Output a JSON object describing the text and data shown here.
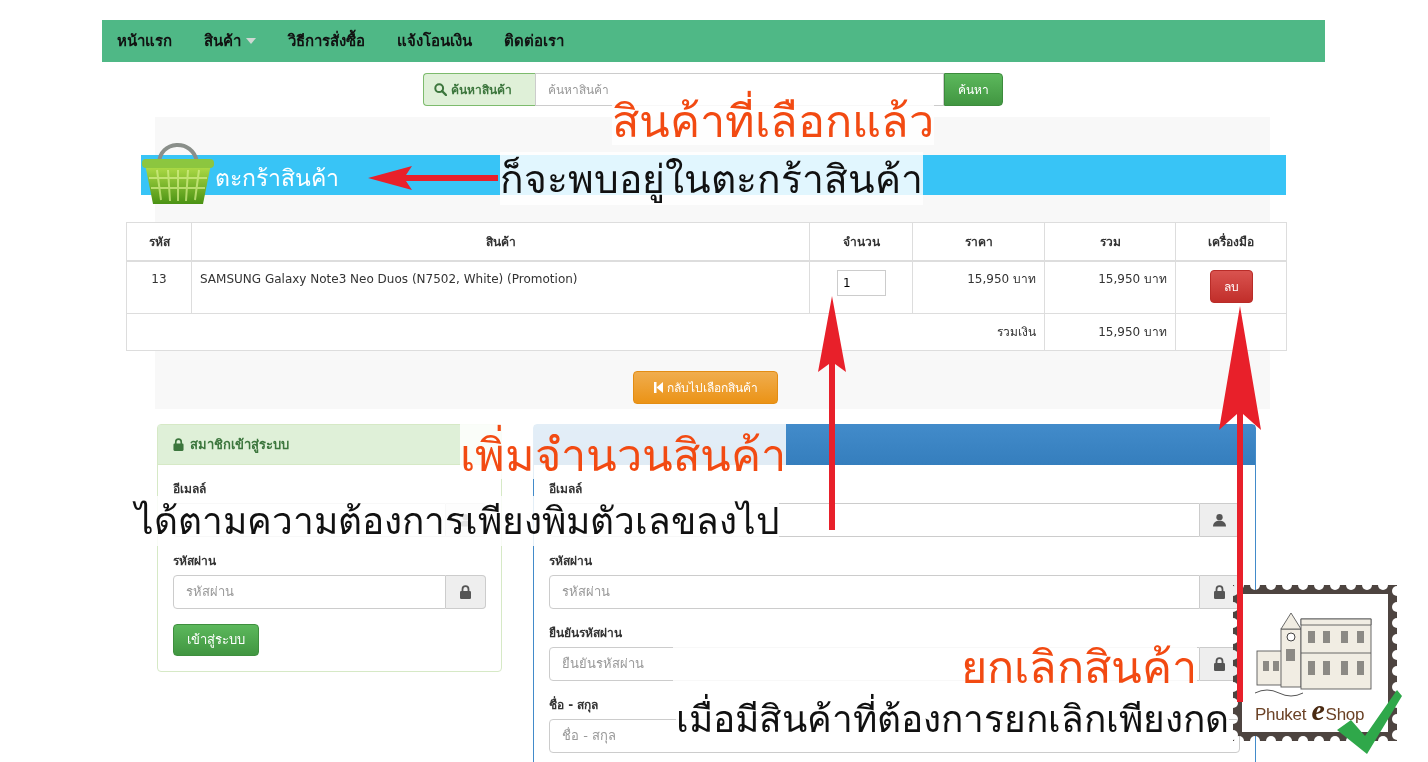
{
  "nav": {
    "items": [
      {
        "label": "หน้าแรก",
        "dropdown": false
      },
      {
        "label": "สินค้า",
        "dropdown": true
      },
      {
        "label": "วิธีการสั่งซื้อ",
        "dropdown": false
      },
      {
        "label": "แจ้งโอนเงิน",
        "dropdown": false
      },
      {
        "label": "ติดต่อเรา",
        "dropdown": false
      }
    ]
  },
  "search": {
    "addon_label": "ค้นหาสินค้า",
    "placeholder": "ค้นหาสินค้า",
    "button": "ค้นหา"
  },
  "cart": {
    "banner_title": "ตะกร้าสินค้า",
    "table": {
      "columns": [
        "รหัส",
        "สินค้า",
        "จำนวน",
        "ราคา",
        "รวม",
        "เครื่องมือ"
      ],
      "rows": [
        {
          "code": "13",
          "product": "SAMSUNG Galaxy Note3 Neo Duos (N7502, White) (Promotion)",
          "quantity": "1",
          "price": "15,950 บาท",
          "total": "15,950 บาท",
          "action": "ลบ"
        }
      ],
      "footer": {
        "label": "รวมเงิน",
        "total": "15,950 บาท"
      }
    },
    "back_button": "กลับไปเลือกสินค้า"
  },
  "login_panel": {
    "title": "สมาชิกเข้าสู่ระบบ",
    "fields": [
      {
        "label": "อีเมลล์",
        "kind": "email"
      },
      {
        "label": "รหัสผ่าน",
        "kind": "password",
        "placeholder": "รหัสผ่าน"
      }
    ],
    "button": "เข้าสู่ระบบ"
  },
  "register_panel": {
    "fields": [
      {
        "label": "อีเมลล์",
        "kind": "email"
      },
      {
        "label": "รหัสผ่าน",
        "kind": "password",
        "placeholder": "รหัสผ่าน"
      },
      {
        "label": "ยืนยันรหัสผ่าน",
        "kind": "password",
        "placeholder": "ยืนยันรหัสผ่าน"
      },
      {
        "label": "ชื่อ - สกุล",
        "kind": "text",
        "placeholder": "ชื่อ - สกุล"
      }
    ]
  },
  "annotations": [
    {
      "title": "สินค้าที่เลือกแล้ว",
      "caption": "ก็จะพบอยู่ในตะกร้าสินค้า"
    },
    {
      "title": "เพิ่มจำนวนสินค้า",
      "caption": "ได้ตามความต้องการเพียงพิมตัวเลขลงไป"
    },
    {
      "title": "ยกเลิกสินค้า",
      "caption": "เมื่อมีสินค้าที่ต้องการยกเลิกเพียงกด"
    }
  ],
  "logo": {
    "wordmark_parts": [
      "Phuket",
      "e",
      "Shop"
    ]
  }
}
